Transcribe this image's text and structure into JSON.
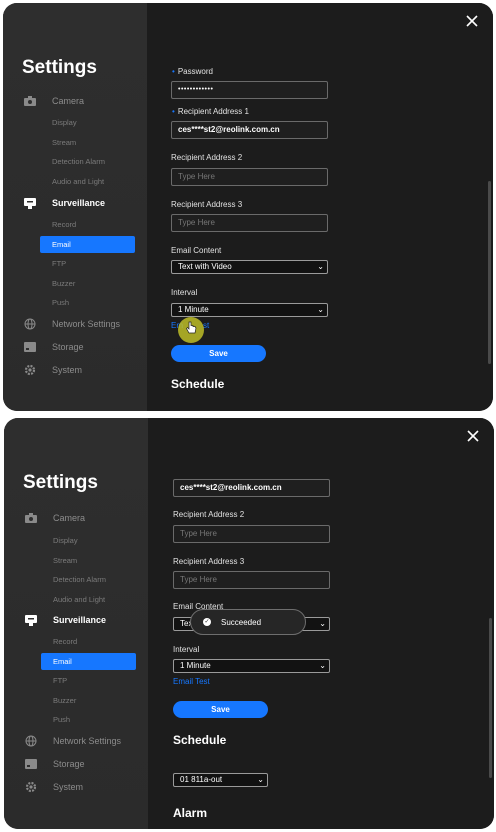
{
  "common": {
    "settings_title": "Settings",
    "close_icon": "close-icon",
    "nav": {
      "camera": "Camera",
      "display": "Display",
      "stream": "Stream",
      "detection_alarm": "Detection Alarm",
      "audio_light": "Audio and Light",
      "surveillance": "Surveillance",
      "record": "Record",
      "email": "Email",
      "ftp": "FTP",
      "buzzer": "Buzzer",
      "push": "Push",
      "network_settings": "Network Settings",
      "storage": "Storage",
      "system": "System"
    },
    "accent_color": "#1677ff"
  },
  "form": {
    "password_label": "Password",
    "password_value": "••••••••••••",
    "recipient1_label": "Recipient Address 1",
    "recipient1_value": "ces****st2@reolink.com.cn",
    "recipient2_label": "Recipient Address 2",
    "recipient2_placeholder": "Type Here",
    "recipient3_label": "Recipient Address 3",
    "recipient3_placeholder": "Type Here",
    "email_content_label": "Email Content",
    "email_content_value": "Text with Video",
    "email_content_partial": "Tex",
    "interval_label": "Interval",
    "interval_value": "1 Minute",
    "email_test_link": "Email Test",
    "email_test_partial": "Em",
    "email_test_partial_end": "st",
    "save_label": "Save",
    "schedule_title": "Schedule",
    "schedule_select_value": "01   811a-out",
    "alarm_title": "Alarm"
  },
  "toast": {
    "message": "Succeeded"
  }
}
